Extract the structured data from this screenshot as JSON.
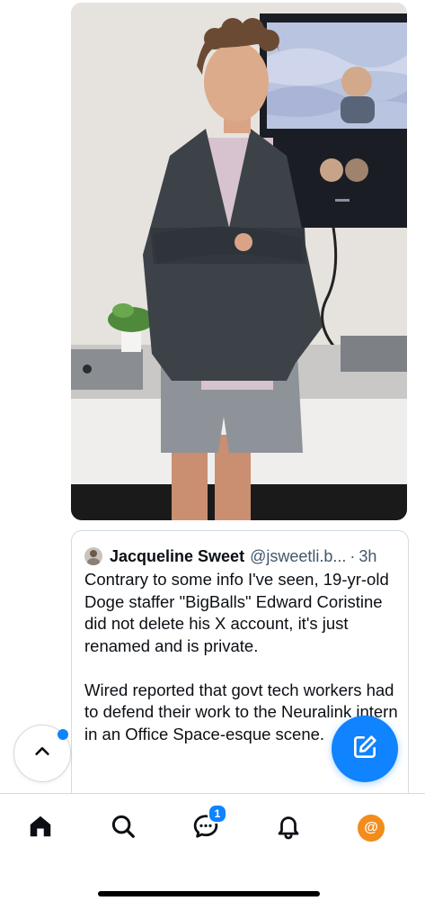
{
  "post_image": {
    "alt": ""
  },
  "quote": {
    "author_name": "Jacqueline Sweet",
    "author_handle": "@jsweetli.b...",
    "separator": "·",
    "time": "3h",
    "paragraphs": [
      "Contrary to some info I've seen, 19-yr-old Doge staffer \"BigBalls\" Edward Coristine did not delete his X account, it's just renamed and is private.",
      "Wired reported that govt tech workers had to defend their work to the Neuralink intern in an Office Space-esque scene."
    ]
  },
  "floating": {
    "scroll_top_icon": "chevron-up-icon",
    "compose_icon": "compose-icon"
  },
  "bottom_nav": {
    "items": [
      {
        "name": "home",
        "icon": "home-icon"
      },
      {
        "name": "search",
        "icon": "search-icon"
      },
      {
        "name": "chat",
        "icon": "chat-icon",
        "badge": "1"
      },
      {
        "name": "notifications",
        "icon": "bell-icon"
      },
      {
        "name": "profile",
        "icon": "avatar",
        "label": "@"
      }
    ]
  },
  "colors": {
    "accent": "#1083fe",
    "text": "#0b0f14",
    "muted": "#42576c",
    "border": "#d4dbe2",
    "profile": "#f28c1c"
  }
}
